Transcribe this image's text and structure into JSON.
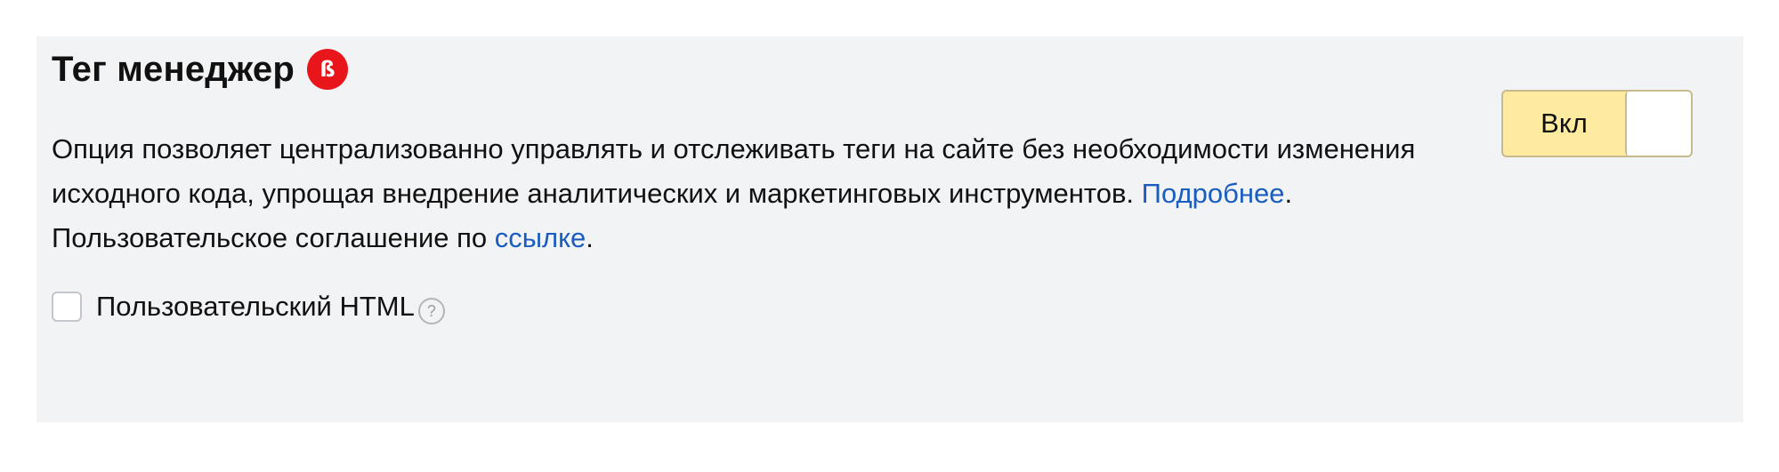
{
  "section": {
    "title": "Тег менеджер",
    "beta_badge": "ß",
    "description_text": "Опция позволяет централизованно управлять и отслеживать теги на сайте без необходимости изменения исходного кода, упрощая внедрение аналитических и маркетинговых инструментов. ",
    "more_link": "Подробнее",
    "agreement_text": ". Пользовательское соглашение по ",
    "agreement_link": "ссылке",
    "end_punct": "."
  },
  "toggle": {
    "label": "Вкл",
    "state": "on"
  },
  "custom_html": {
    "label": "Пользовательский HTML",
    "checked": false,
    "help_icon": "?"
  },
  "colors": {
    "panel_bg": "#f2f3f5",
    "toggle_on_bg": "#ffeba0",
    "beta_badge_bg": "#e8151b",
    "link": "#1b5dbf"
  }
}
